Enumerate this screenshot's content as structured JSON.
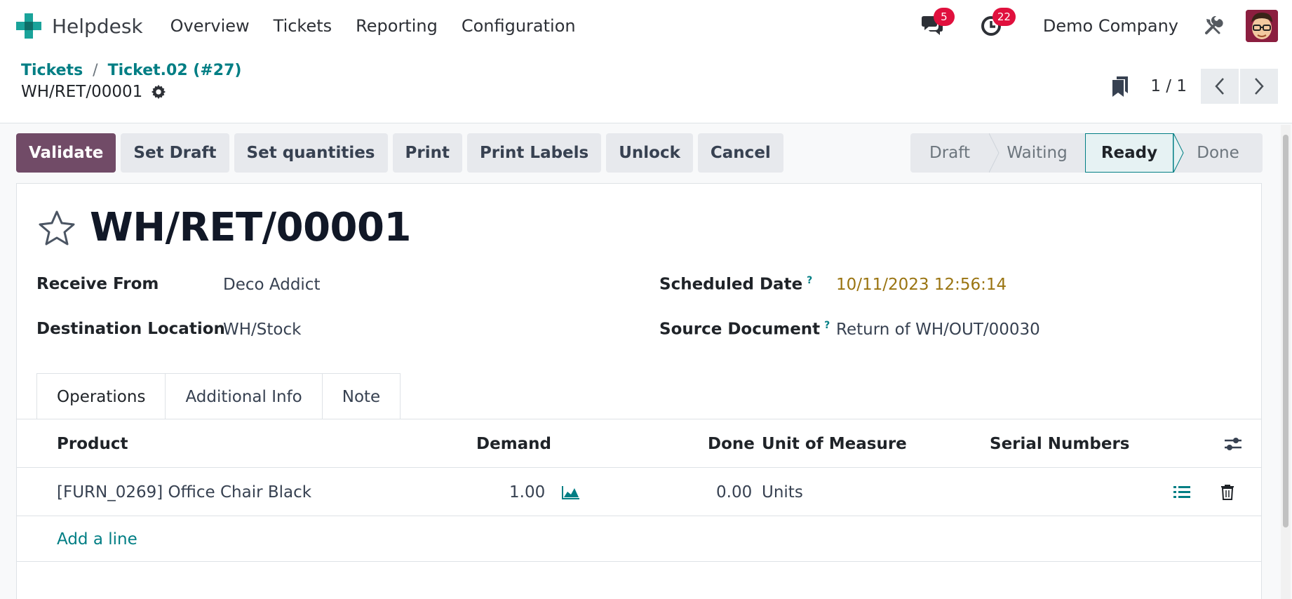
{
  "navbar": {
    "app_name": "Helpdesk",
    "menu": [
      "Overview",
      "Tickets",
      "Reporting",
      "Configuration"
    ],
    "messages_count": "5",
    "activities_count": "22",
    "company": "Demo Company"
  },
  "breadcrumb": {
    "root": "Tickets",
    "separator": "/",
    "parent": "Ticket.02 (#27)",
    "current": "WH/RET/00001"
  },
  "pager": {
    "value": "1 / 1"
  },
  "actions": {
    "validate": "Validate",
    "set_draft": "Set Draft",
    "set_quantities": "Set quantities",
    "print": "Print",
    "print_labels": "Print Labels",
    "unlock": "Unlock",
    "cancel": "Cancel"
  },
  "statusbar": {
    "stages": [
      "Draft",
      "Waiting",
      "Ready",
      "Done"
    ],
    "active": "Ready"
  },
  "form": {
    "name": "WH/RET/00001",
    "receive_from_label": "Receive From",
    "receive_from_value": "Deco Addict",
    "destination_label": "Destination Location",
    "destination_value": "WH/Stock",
    "scheduled_date_label": "Scheduled Date",
    "scheduled_date_value": "10/11/2023 12:56:14",
    "source_document_label": "Source Document",
    "source_document_value": "Return of WH/OUT/00030",
    "help_mark": "?"
  },
  "tabs": [
    "Operations",
    "Additional Info",
    "Note"
  ],
  "operations": {
    "columns": {
      "product": "Product",
      "demand": "Demand",
      "done": "Done",
      "uom": "Unit of Measure",
      "serials": "Serial Numbers"
    },
    "rows": [
      {
        "product": "[FURN_0269] Office Chair Black",
        "demand": "1.00",
        "done": "0.00",
        "uom": "Units",
        "serials": ""
      }
    ],
    "add_line": "Add a line"
  },
  "colors": {
    "primary": "#714b67",
    "link": "#017e84",
    "warning_date": "#9a7411",
    "badge": "#e0103d"
  }
}
